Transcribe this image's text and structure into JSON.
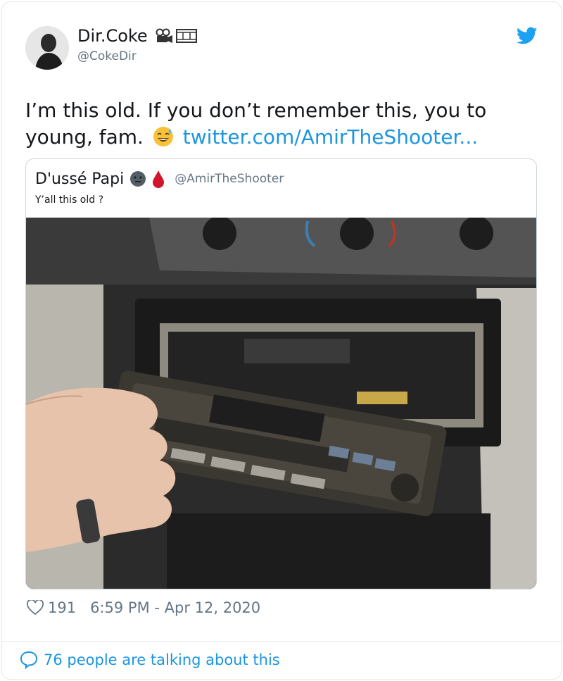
{
  "author": {
    "display_name": "Dir.Coke",
    "handle": "@CokeDir",
    "avatar_icon": "avatar-photo",
    "name_emojis": [
      "movie-camera-icon",
      "film-frames-icon"
    ]
  },
  "tweet": {
    "text_part1": "I’m this old. If you don’t remember this, you to young, fam.",
    "emoji": "sweat-smile-icon",
    "link": "twitter.com/AmirTheShooter..."
  },
  "quoted": {
    "display_name": "D'ussé Papi",
    "name_emojis": [
      "dark-face-icon",
      "blood-drop-icon"
    ],
    "handle": "@AmirTheShooter",
    "text": "Y’all this old ?",
    "image_icon": "car-stereo-faceplate-photo"
  },
  "footer": {
    "likes": "191",
    "time": "6:59 PM - Apr 12, 2020",
    "talking": "76 people are talking about this"
  },
  "colors": {
    "link": "#1b95e0",
    "secondary_text": "#657786",
    "border": "#e1e8ed"
  }
}
